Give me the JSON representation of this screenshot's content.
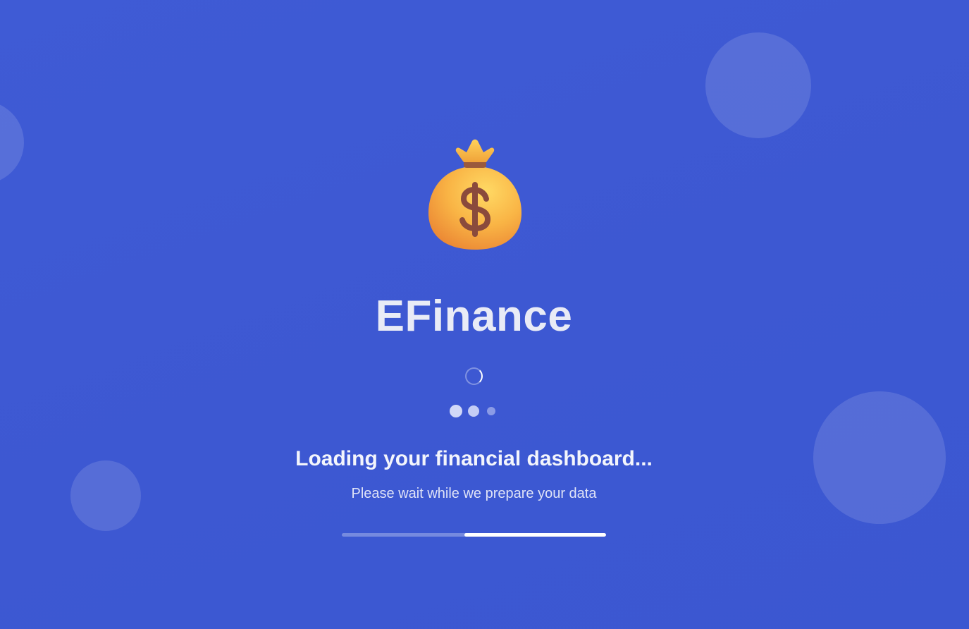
{
  "app": {
    "name": "EFinance",
    "logo_icon": "money-bag-icon"
  },
  "loading": {
    "title": "Loading your financial dashboard...",
    "subtitle": "Please wait while we prepare your data",
    "progress_fill_start": 0.465,
    "progress_fill_end": 1.0
  },
  "colors": {
    "background": "#3e59d4",
    "text": "#f3f5fc",
    "bag": "#f5a93a",
    "dollar": "#8a4a3c"
  }
}
